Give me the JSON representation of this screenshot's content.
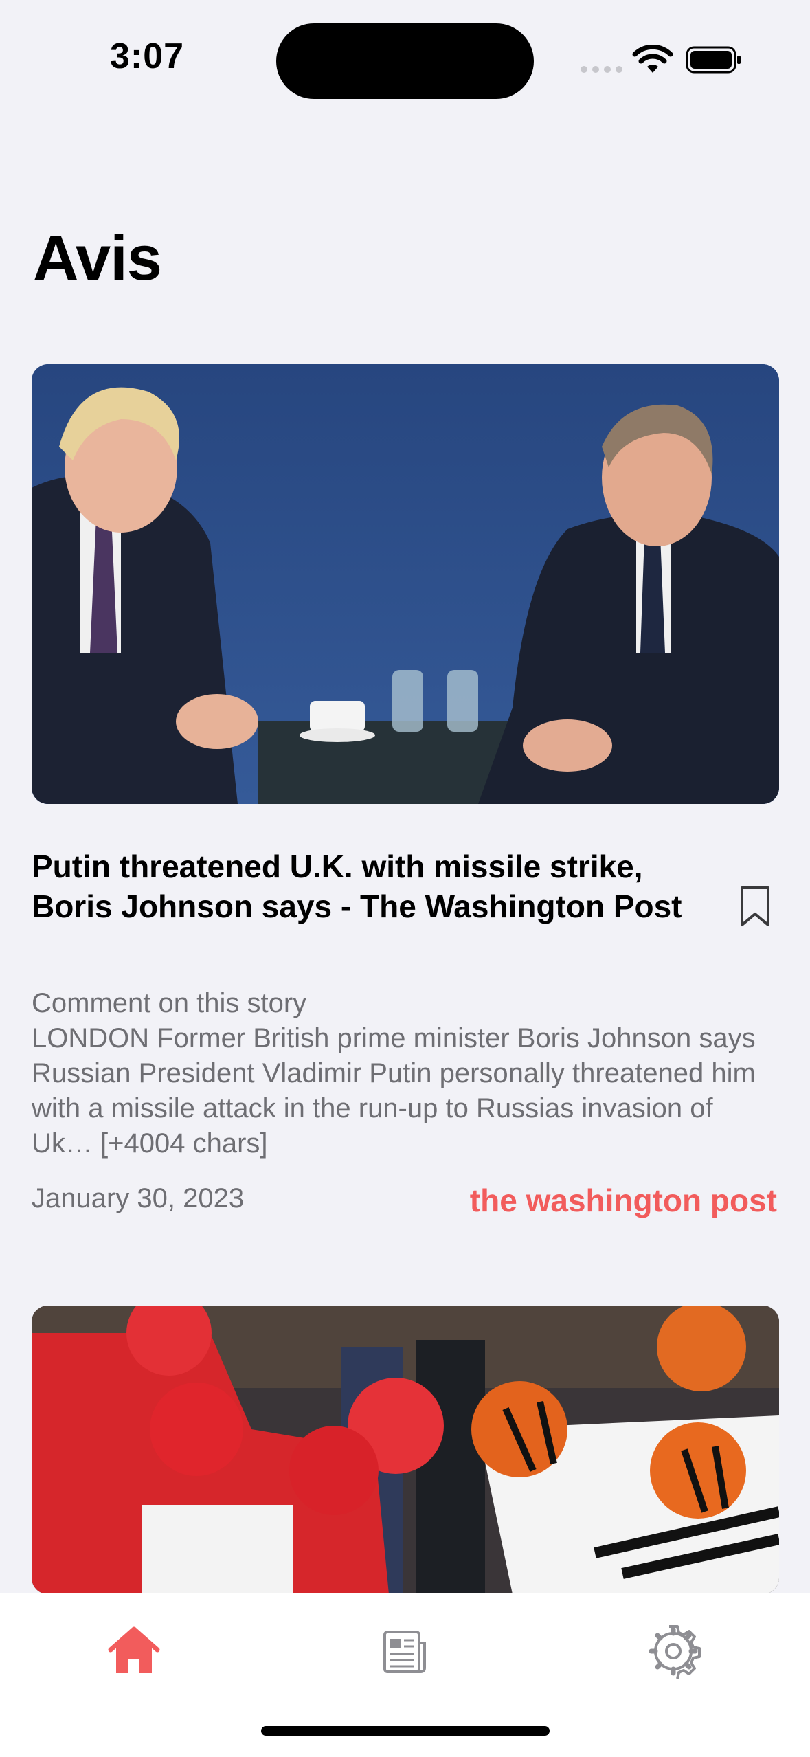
{
  "status_bar": {
    "time": "3:07"
  },
  "page": {
    "title": "Avis"
  },
  "articles": [
    {
      "title": "Putin threatened U.K. with missile strike, Boris Johnson says - The Washington Post",
      "description": "Comment on this story\nLONDON Former British prime minister Boris Johnson says Russian President Vladimir Putin personally threatened him with a missile attack in the run-up to Russias invasion of Uk… [+4004 chars]",
      "date": "January 30, 2023",
      "source": "the washington post"
    }
  ],
  "tab_bar": {
    "tabs": [
      {
        "icon": "home-icon",
        "active": true
      },
      {
        "icon": "newspaper-icon",
        "active": false
      },
      {
        "icon": "gear-icon",
        "active": false
      }
    ]
  },
  "colors": {
    "accent": "#f25c5c",
    "background": "#f2f2f7",
    "secondary_text": "#6e6e73"
  }
}
